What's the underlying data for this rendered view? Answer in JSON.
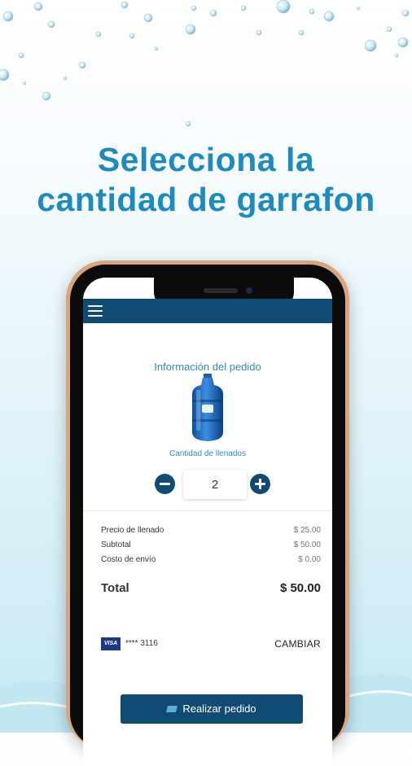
{
  "headline": {
    "line1": "Selecciona la",
    "line2": "cantidad de garrafon"
  },
  "colors": {
    "headline": "#1d8ac0",
    "appbar": "#0f4b73",
    "accent_text": "#2a8fc3",
    "phone_frame": "#d8a57c"
  },
  "icons": {
    "menu": "hamburger-icon",
    "minus": "minus-circle-icon",
    "plus": "plus-circle-icon",
    "card": "visa-card-icon",
    "order": "ticket-icon"
  },
  "order": {
    "title": "Información del pedido",
    "quantity_label": "Cantidad de llenados",
    "quantity": "2"
  },
  "summary": {
    "rows": [
      {
        "label": "Precio de llenado",
        "value": "$ 25.00"
      },
      {
        "label": "Subtotal",
        "value": "$ 50.00"
      },
      {
        "label": "Costo de envío",
        "value": "$ 0.00"
      }
    ],
    "total_label": "Total",
    "total_value": "$ 50.00"
  },
  "payment": {
    "card_brand": "VISA",
    "card_number": "**** 3116",
    "change_label": "CAMBIAR"
  },
  "actions": {
    "submit_label": "Realizar pedido"
  }
}
